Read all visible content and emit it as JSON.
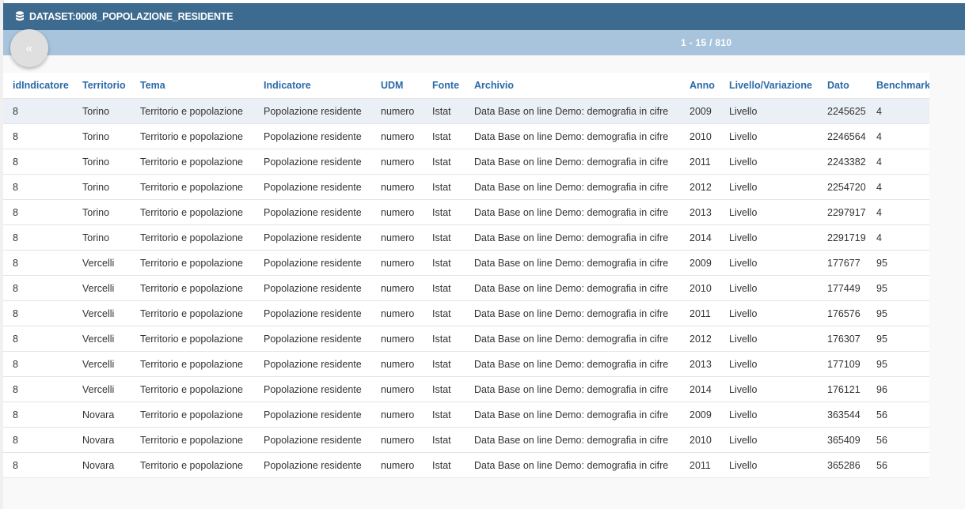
{
  "header": {
    "title": "DATASET:0008_POPOLAZIONE_RESIDENTE",
    "icon": "database-icon",
    "colors": {
      "titlebar": "#3d6a8f",
      "pagerbar": "#a8c4dc",
      "column_header_text": "#2a6aa8"
    }
  },
  "pager": {
    "prev_label": "«",
    "range_text": "1 - 15 / 810"
  },
  "table": {
    "columns": [
      "idIndicatore",
      "Territorio",
      "Tema",
      "Indicatore",
      "UDM",
      "Fonte",
      "Archivio",
      "Anno",
      "Livello/Variazione",
      "Dato",
      "Benchmark"
    ],
    "rows": [
      [
        "8",
        "Torino",
        "Territorio e popolazione",
        "Popolazione residente",
        "numero",
        "Istat",
        "Data Base on line Demo: demografia in cifre",
        "2009",
        "Livello",
        "2245625",
        "4"
      ],
      [
        "8",
        "Torino",
        "Territorio e popolazione",
        "Popolazione residente",
        "numero",
        "Istat",
        "Data Base on line Demo: demografia in cifre",
        "2010",
        "Livello",
        "2246564",
        "4"
      ],
      [
        "8",
        "Torino",
        "Territorio e popolazione",
        "Popolazione residente",
        "numero",
        "Istat",
        "Data Base on line Demo: demografia in cifre",
        "2011",
        "Livello",
        "2243382",
        "4"
      ],
      [
        "8",
        "Torino",
        "Territorio e popolazione",
        "Popolazione residente",
        "numero",
        "Istat",
        "Data Base on line Demo: demografia in cifre",
        "2012",
        "Livello",
        "2254720",
        "4"
      ],
      [
        "8",
        "Torino",
        "Territorio e popolazione",
        "Popolazione residente",
        "numero",
        "Istat",
        "Data Base on line Demo: demografia in cifre",
        "2013",
        "Livello",
        "2297917",
        "4"
      ],
      [
        "8",
        "Torino",
        "Territorio e popolazione",
        "Popolazione residente",
        "numero",
        "Istat",
        "Data Base on line Demo: demografia in cifre",
        "2014",
        "Livello",
        "2291719",
        "4"
      ],
      [
        "8",
        "Vercelli",
        "Territorio e popolazione",
        "Popolazione residente",
        "numero",
        "Istat",
        "Data Base on line Demo: demografia in cifre",
        "2009",
        "Livello",
        "177677",
        "95"
      ],
      [
        "8",
        "Vercelli",
        "Territorio e popolazione",
        "Popolazione residente",
        "numero",
        "Istat",
        "Data Base on line Demo: demografia in cifre",
        "2010",
        "Livello",
        "177449",
        "95"
      ],
      [
        "8",
        "Vercelli",
        "Territorio e popolazione",
        "Popolazione residente",
        "numero",
        "Istat",
        "Data Base on line Demo: demografia in cifre",
        "2011",
        "Livello",
        "176576",
        "95"
      ],
      [
        "8",
        "Vercelli",
        "Territorio e popolazione",
        "Popolazione residente",
        "numero",
        "Istat",
        "Data Base on line Demo: demografia in cifre",
        "2012",
        "Livello",
        "176307",
        "95"
      ],
      [
        "8",
        "Vercelli",
        "Territorio e popolazione",
        "Popolazione residente",
        "numero",
        "Istat",
        "Data Base on line Demo: demografia in cifre",
        "2013",
        "Livello",
        "177109",
        "95"
      ],
      [
        "8",
        "Vercelli",
        "Territorio e popolazione",
        "Popolazione residente",
        "numero",
        "Istat",
        "Data Base on line Demo: demografia in cifre",
        "2014",
        "Livello",
        "176121",
        "96"
      ],
      [
        "8",
        "Novara",
        "Territorio e popolazione",
        "Popolazione residente",
        "numero",
        "Istat",
        "Data Base on line Demo: demografia in cifre",
        "2009",
        "Livello",
        "363544",
        "56"
      ],
      [
        "8",
        "Novara",
        "Territorio e popolazione",
        "Popolazione residente",
        "numero",
        "Istat",
        "Data Base on line Demo: demografia in cifre",
        "2010",
        "Livello",
        "365409",
        "56"
      ],
      [
        "8",
        "Novara",
        "Territorio e popolazione",
        "Popolazione residente",
        "numero",
        "Istat",
        "Data Base on line Demo: demografia in cifre",
        "2011",
        "Livello",
        "365286",
        "56"
      ]
    ],
    "selected_row": 0
  }
}
